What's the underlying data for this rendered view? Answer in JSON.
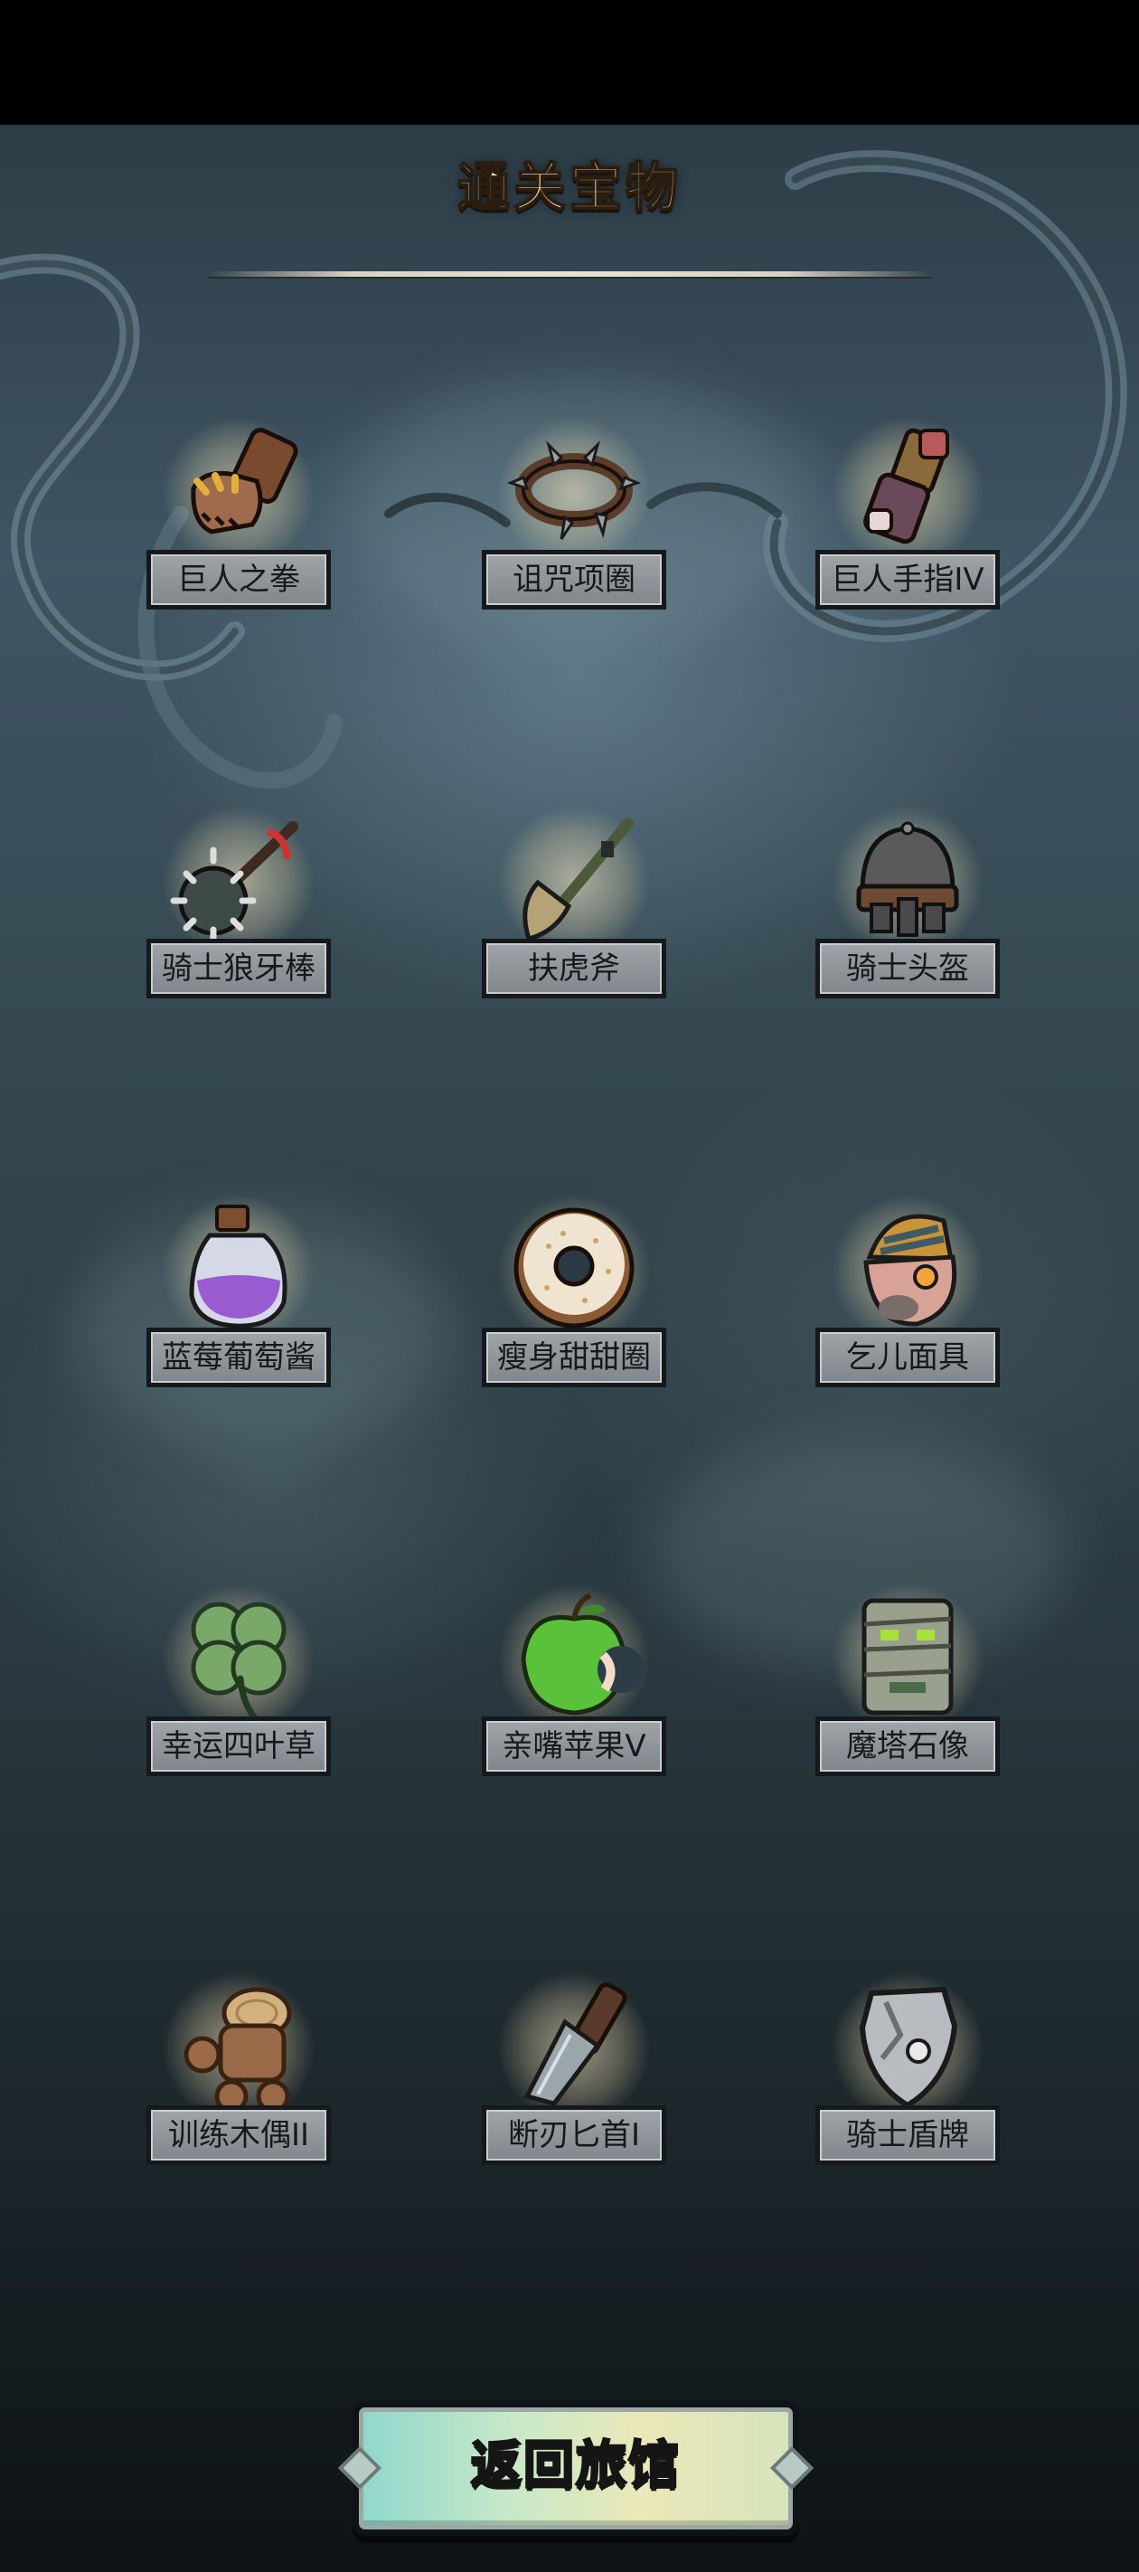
{
  "screen": {
    "title": "通关宝物",
    "return_button_label": "返回旅馆"
  },
  "treasures": [
    {
      "name": "巨人之拳",
      "icon": "giant-fist-icon"
    },
    {
      "name": "诅咒项圈",
      "icon": "spiked-collar-icon"
    },
    {
      "name": "巨人手指IV",
      "icon": "giant-finger-icon"
    },
    {
      "name": "骑士狼牙棒",
      "icon": "spiked-mace-icon"
    },
    {
      "name": "扶虎斧",
      "icon": "axe-icon"
    },
    {
      "name": "骑士头盔",
      "icon": "knight-helmet-icon"
    },
    {
      "name": "蓝莓葡萄酱",
      "icon": "potion-bottle-icon"
    },
    {
      "name": "瘦身甜甜圈",
      "icon": "donut-icon"
    },
    {
      "name": "乞儿面具",
      "icon": "beggar-mask-icon"
    },
    {
      "name": "幸运四叶草",
      "icon": "four-leaf-clover-icon"
    },
    {
      "name": "亲嘴苹果V",
      "icon": "bitten-apple-icon"
    },
    {
      "name": "魔塔石像",
      "icon": "stone-totem-icon"
    },
    {
      "name": "训练木偶II",
      "icon": "wooden-dummy-icon"
    },
    {
      "name": "断刃匕首I",
      "icon": "broken-dagger-icon"
    },
    {
      "name": "骑士盾牌",
      "icon": "knight-shield-icon"
    }
  ]
}
